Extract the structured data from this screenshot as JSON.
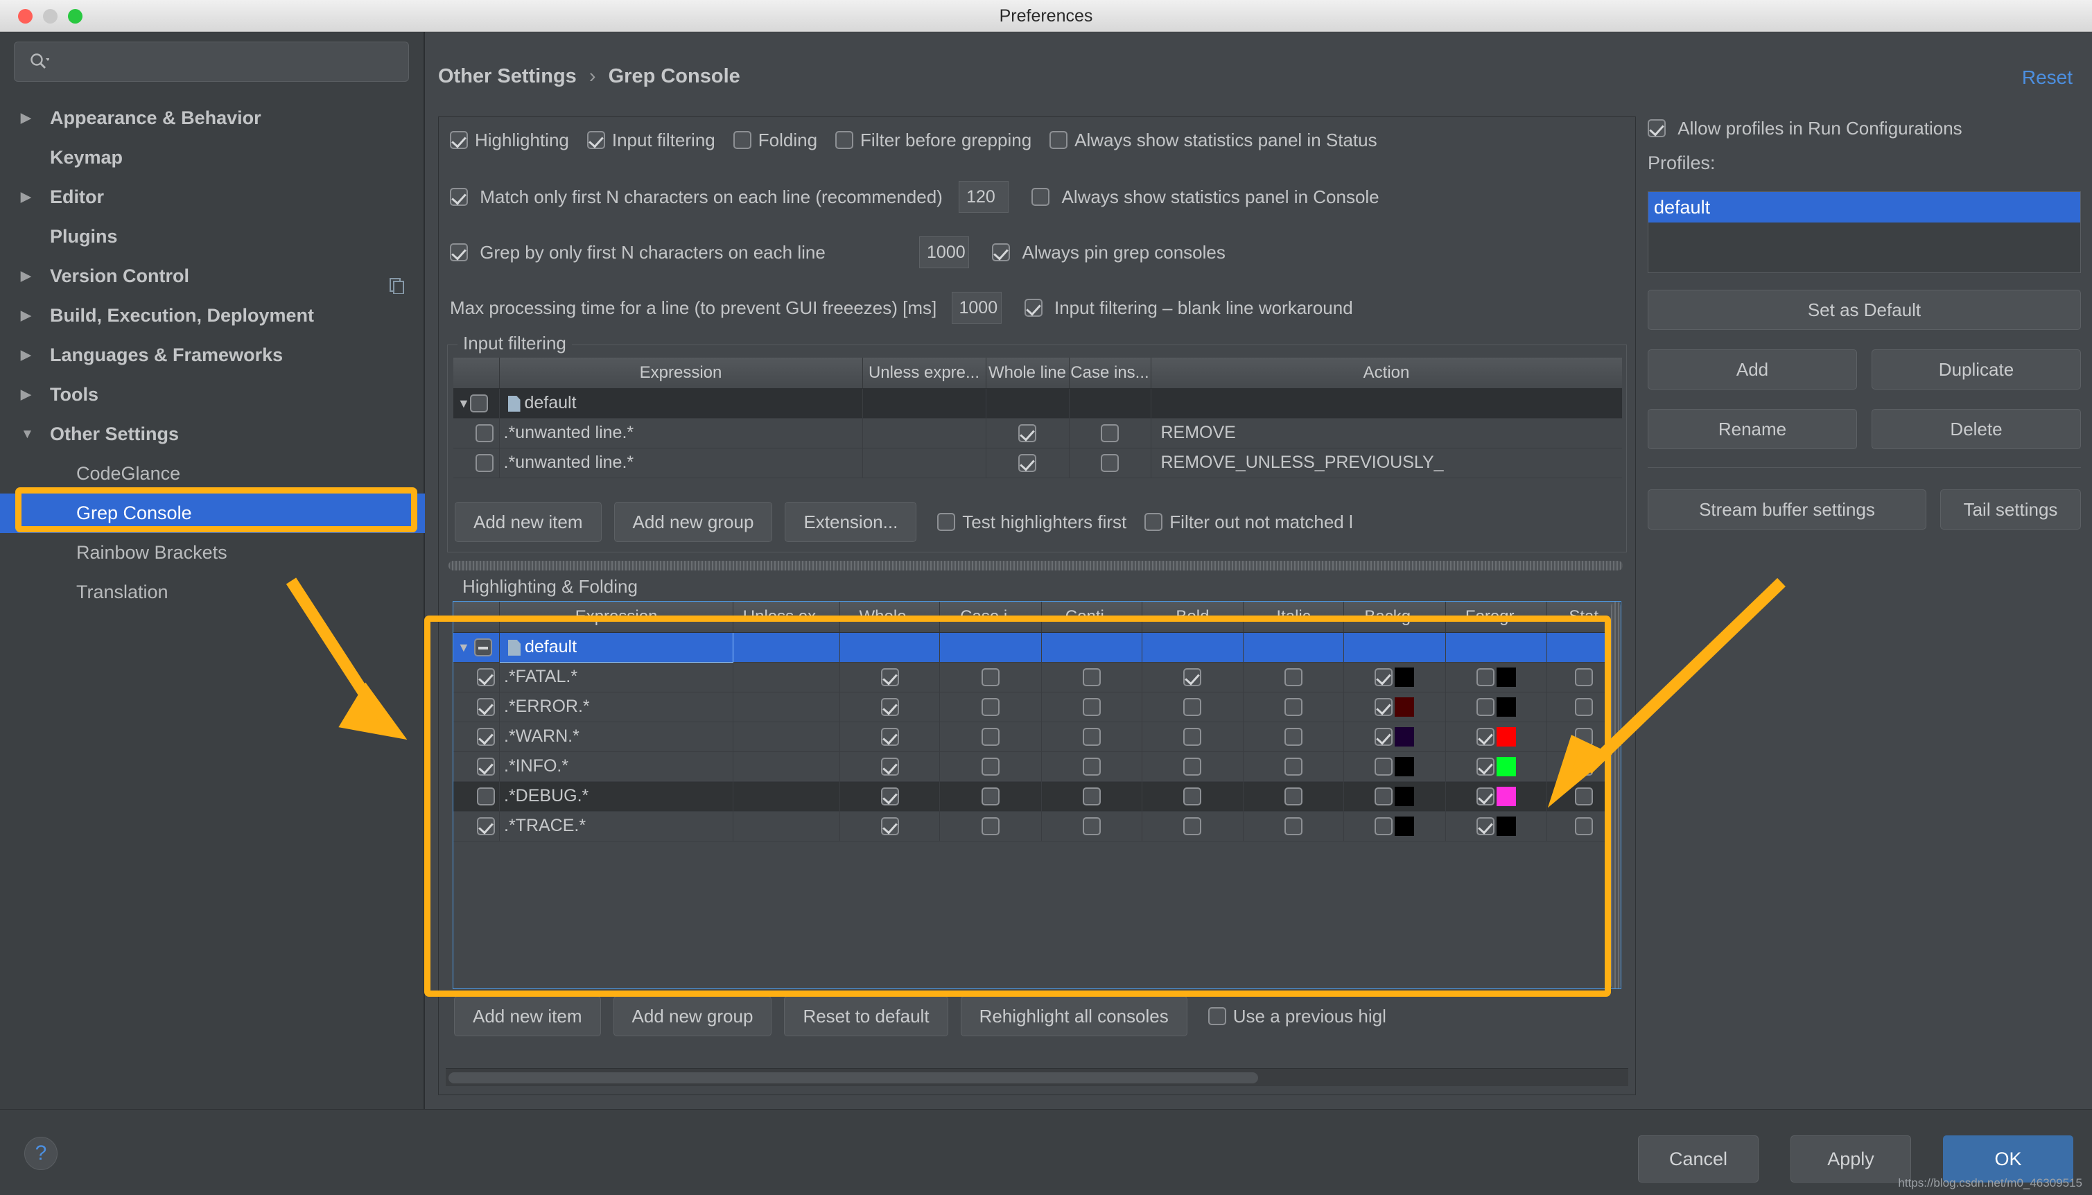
{
  "window": {
    "title": "Preferences"
  },
  "sidebar": {
    "search_placeholder": "",
    "items": [
      {
        "label": "Appearance & Behavior",
        "expandable": true,
        "child": false
      },
      {
        "label": "Keymap",
        "expandable": false,
        "child": false
      },
      {
        "label": "Editor",
        "expandable": true,
        "child": false
      },
      {
        "label": "Plugins",
        "expandable": false,
        "child": false
      },
      {
        "label": "Version Control",
        "expandable": true,
        "child": false
      },
      {
        "label": "Build, Execution, Deployment",
        "expandable": true,
        "child": false
      },
      {
        "label": "Languages & Frameworks",
        "expandable": true,
        "child": false
      },
      {
        "label": "Tools",
        "expandable": true,
        "child": false
      },
      {
        "label": "Other Settings",
        "expandable": true,
        "child": false,
        "expanded": true
      },
      {
        "label": "CodeGlance",
        "expandable": false,
        "child": true
      },
      {
        "label": "Grep Console",
        "expandable": false,
        "child": true,
        "selected": true
      },
      {
        "label": "Rainbow Brackets",
        "expandable": false,
        "child": true
      },
      {
        "label": "Translation",
        "expandable": false,
        "child": true
      }
    ]
  },
  "header": {
    "breadcrumb_parent": "Other Settings",
    "breadcrumb_sep": "›",
    "breadcrumb_current": "Grep Console",
    "reset_label": "Reset"
  },
  "options": {
    "row1": [
      {
        "label": "Highlighting",
        "checked": true
      },
      {
        "label": "Input filtering",
        "checked": true
      },
      {
        "label": "Folding",
        "checked": false
      },
      {
        "label": "Filter before grepping",
        "checked": false
      },
      {
        "label": "Always show statistics panel in Status",
        "checked": false
      }
    ],
    "row2": {
      "label": "Match only first N characters on each line (recommended)",
      "checked": true,
      "value": "120",
      "right_label": "Always show statistics panel in Console",
      "right_checked": false
    },
    "row3": {
      "label": "Grep by only first N characters on each line",
      "checked": true,
      "value": "1000",
      "right_label": "Always pin grep consoles",
      "right_checked": true
    },
    "row4": {
      "label": "Max processing time for a line (to prevent GUI freeezes) [ms]",
      "value": "1000",
      "right_label": "Input filtering – blank line workaround",
      "right_checked": true
    }
  },
  "input_filtering": {
    "title": "Input filtering",
    "columns": [
      "",
      "Expression",
      "Unless expre...",
      "Whole line",
      "Case ins...",
      "Action"
    ],
    "rows": [
      {
        "kind": "group",
        "expression": "default",
        "enabled": false,
        "whole": null,
        "caseins": null,
        "action": ""
      },
      {
        "kind": "item",
        "expression": ".*unwanted line.*",
        "enabled": false,
        "whole": true,
        "caseins": false,
        "action": "REMOVE"
      },
      {
        "kind": "item",
        "expression": ".*unwanted line.*",
        "enabled": false,
        "whole": true,
        "caseins": false,
        "action": "REMOVE_UNLESS_PREVIOUSLY_"
      }
    ],
    "buttons": [
      "Add new item",
      "Add new group",
      "Extension..."
    ],
    "checkboxes": [
      {
        "label": "Test highlighters first",
        "checked": false
      },
      {
        "label": "Filter out not matched l",
        "checked": false
      }
    ]
  },
  "highlighting": {
    "title": "Highlighting & Folding",
    "columns": [
      "",
      "Expression",
      "Unless ex...",
      "Whole...",
      "Case i...",
      "Conti...",
      "Bold",
      "Italic",
      "Backg...",
      "Foregr...",
      "Stat"
    ],
    "rows": [
      {
        "kind": "group",
        "expression": "default",
        "selected": true,
        "enabled": null,
        "whole": null,
        "caseins": null,
        "conti": null,
        "bold": null,
        "italic": null,
        "bg_on": null,
        "bg_color": null,
        "fg_on": null,
        "fg_color": null
      },
      {
        "kind": "item",
        "expression": ".*FATAL.*",
        "enabled": true,
        "whole": true,
        "caseins": false,
        "conti": false,
        "bold": true,
        "italic": false,
        "bg_on": true,
        "bg_color": "#000000",
        "fg_on": false,
        "fg_color": "#000000"
      },
      {
        "kind": "item",
        "expression": ".*ERROR.*",
        "enabled": true,
        "whole": true,
        "caseins": false,
        "conti": false,
        "bold": false,
        "italic": false,
        "bg_on": true,
        "bg_color": "#4a0000",
        "fg_on": false,
        "fg_color": "#000000"
      },
      {
        "kind": "item",
        "expression": ".*WARN.*",
        "enabled": true,
        "whole": true,
        "caseins": false,
        "conti": false,
        "bold": false,
        "italic": false,
        "bg_on": true,
        "bg_color": "#1a0033",
        "fg_on": true,
        "fg_color": "#ff0000"
      },
      {
        "kind": "item",
        "expression": ".*INFO.*",
        "enabled": true,
        "whole": true,
        "caseins": false,
        "conti": false,
        "bold": false,
        "italic": false,
        "bg_on": false,
        "bg_color": "#000000",
        "fg_on": true,
        "fg_color": "#00ff2a"
      },
      {
        "kind": "item",
        "expression": ".*DEBUG.*",
        "enabled": false,
        "alt": true,
        "whole": true,
        "caseins": false,
        "conti": false,
        "bold": false,
        "italic": false,
        "bg_on": false,
        "bg_color": "#000000",
        "fg_on": true,
        "fg_color": "#ff2fe0"
      },
      {
        "kind": "item",
        "expression": ".*TRACE.*",
        "enabled": true,
        "whole": true,
        "caseins": false,
        "conti": false,
        "bold": false,
        "italic": false,
        "bg_on": false,
        "bg_color": "#000000",
        "fg_on": true,
        "fg_color": "#000000"
      }
    ],
    "buttons": [
      "Add new item",
      "Add new group",
      "Reset to default",
      "Rehighlight all consoles"
    ],
    "checkbox": {
      "label": "Use a previous higl",
      "checked": false
    }
  },
  "profiles": {
    "allow_label": "Allow profiles in Run Configurations",
    "allow_checked": true,
    "list_label": "Profiles:",
    "items": [
      "default"
    ],
    "selected": "default",
    "set_default_label": "Set as Default",
    "add_label": "Add",
    "duplicate_label": "Duplicate",
    "rename_label": "Rename",
    "delete_label": "Delete",
    "stream_buffer_label": "Stream buffer settings",
    "tail_label": "Tail settings"
  },
  "footer": {
    "help_glyph": "?",
    "cancel_label": "Cancel",
    "apply_label": "Apply",
    "ok_label": "OK",
    "watermark": "https://blog.csdn.net/m0_46309515"
  }
}
